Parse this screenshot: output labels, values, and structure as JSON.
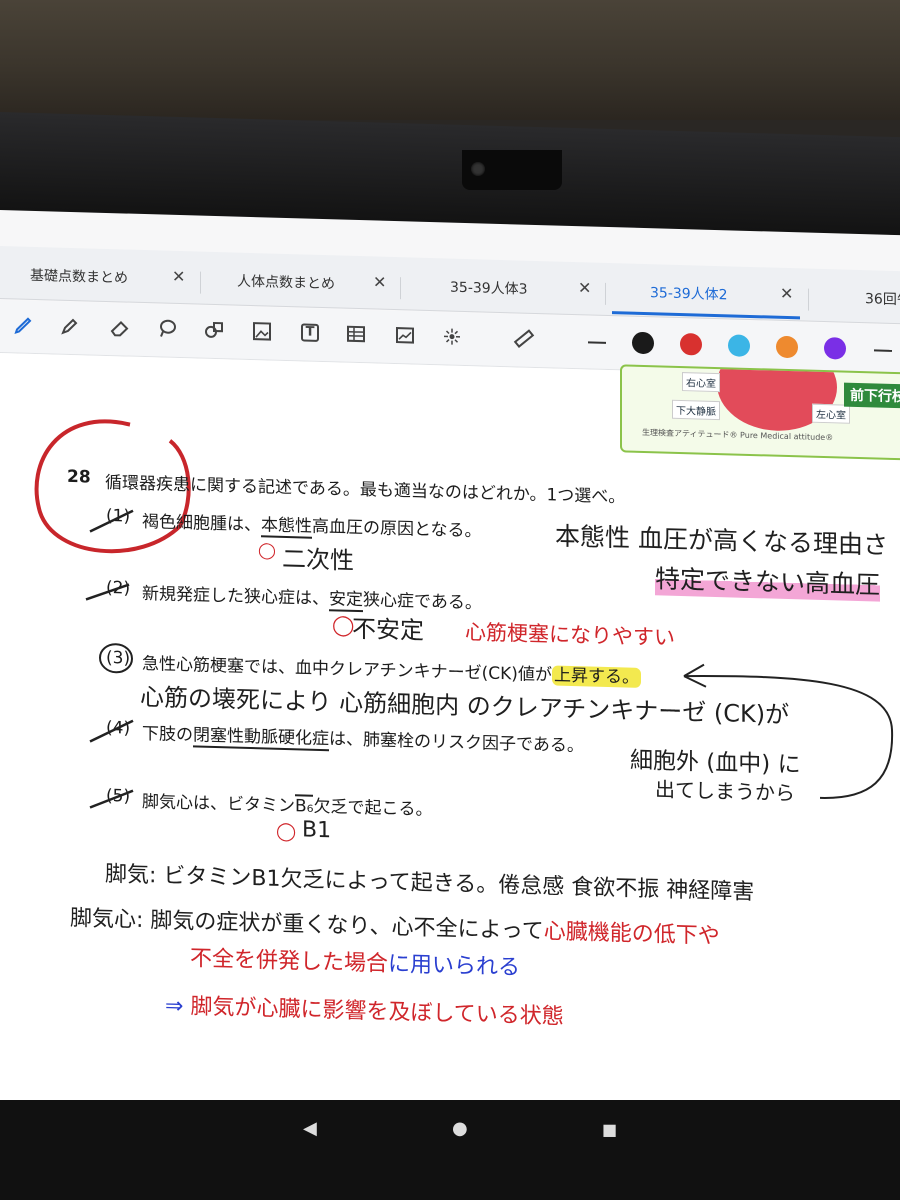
{
  "tabs": [
    {
      "label": "基礎点数まとめ",
      "close": "✕"
    },
    {
      "label": "人体点数まとめ",
      "close": "✕"
    },
    {
      "label": "35-39人体3",
      "close": "✕"
    },
    {
      "label": "35-39人体2",
      "close": "✕",
      "active": true
    },
    {
      "label": "36回午",
      "close": ""
    }
  ],
  "toolbar": {
    "icons": [
      "pen-icon",
      "highlighter-icon",
      "eraser-icon",
      "lasso-icon",
      "shapes-icon",
      "image-icon",
      "text-icon",
      "table-icon",
      "chart-icon",
      "laser-icon",
      "ruler-icon"
    ],
    "text_glyph": "T",
    "colors": [
      "#1a1a1a",
      "#d8312f",
      "#3bb5e6",
      "#ee8a2f",
      "#7a2fe6"
    ]
  },
  "figure": {
    "labels": [
      "右心室",
      "下大静脈",
      "左心室",
      "前下行枝"
    ],
    "footer": "生理検査アティテュード®   Pure Medical attitude®"
  },
  "question": {
    "number": "28",
    "stem": "循環器疾患に関する記述である。最も適当なのはどれか。1つ選べ。",
    "options": [
      {
        "num": "(1)",
        "pre": "褐色細胞腫は、",
        "key": "本態性",
        "post": "高血圧の原因となる。"
      },
      {
        "num": "(2)",
        "pre": "新規発症した狭心症は、",
        "key": "安定",
        "post": "狭心症である。"
      },
      {
        "num": "(3)",
        "pre": "急性心筋梗塞では、血中クレアチンキナーゼ(CK)値が",
        "key": "上昇する。",
        "post": ""
      },
      {
        "num": "(4)",
        "pre": "下肢の",
        "key": "閉塞性動脈硬化症",
        "post": "は、肺塞栓のリスク因子である。"
      },
      {
        "num": "(5)",
        "pre": "脚気心は、ビタミン",
        "key": "B₆",
        "post": "欠乏で起こる。"
      }
    ]
  },
  "notes": {
    "n1a": "本態性 血圧が高くなる理由さ",
    "n1b": "特定できない高血圧",
    "a1": "二次性",
    "a2": "不安定",
    "a2b": "心筋梗塞になりやすい",
    "n3a": "心筋の壊死により 心筋細胞内 のクレアチンキナーゼ (CK)が",
    "n3b": "細胞外 (血中) に",
    "n3c": "出てしまうから",
    "a5": "B1",
    "k1": "脚気: ビタミンB1欠乏によって起きる。倦怠感 食欲不振 神経障害",
    "k2a": "脚気心: 脚気の症状が重くなり、心不全によって",
    "k2b": "心臓機能の低下や",
    "k2c": "不全を併発した場合",
    "k2d": "に用いられる",
    "k3a": "⇒",
    "k3b": "脚気が心臓に影響を及ぼしている状態"
  },
  "nav": {
    "back": "◀",
    "home": "●",
    "recents": "■"
  }
}
